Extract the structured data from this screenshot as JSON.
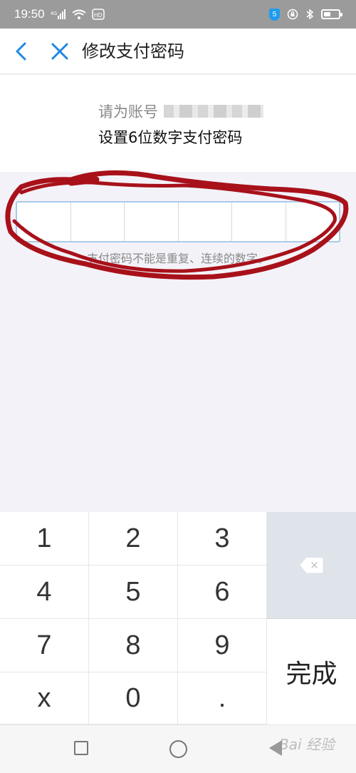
{
  "status_bar": {
    "time": "19:50",
    "network": "4G",
    "hd": "HD",
    "shield": "5"
  },
  "nav": {
    "title": "修改支付密码",
    "back_icon": "chevron-left-icon",
    "close_icon": "close-icon"
  },
  "info": {
    "account_label": "请为账号",
    "instruction": "设置6位数字支付密码"
  },
  "password": {
    "digits": [
      "",
      "",
      "",
      "",
      "",
      ""
    ],
    "hint": "支付密码不能是重复、连续的数字。"
  },
  "keypad": {
    "keys": [
      "1",
      "2",
      "3",
      "4",
      "5",
      "6",
      "7",
      "8",
      "9",
      "x",
      "0",
      "."
    ],
    "delete_icon": "backspace-icon",
    "done_label": "完成"
  },
  "watermark": "Bai 经验",
  "colors": {
    "accent": "#1e88e5",
    "annotation": "#a8111a",
    "status_bar": "#9b9b9b",
    "box_border": "#a9cbe7"
  }
}
